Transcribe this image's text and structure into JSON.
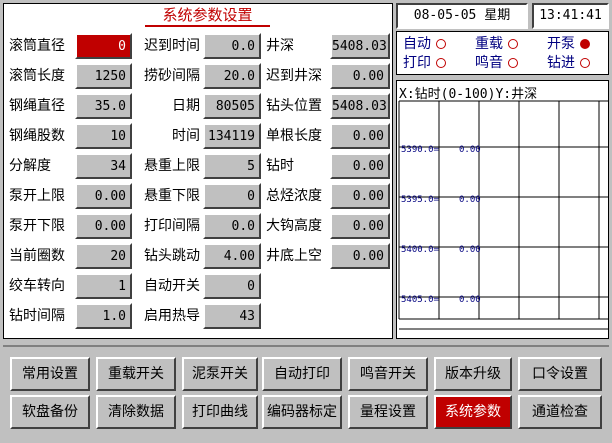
{
  "header": {
    "title": "系统参数设置",
    "date": "08-05-05",
    "weekday": "星期",
    "time": "13:41:41"
  },
  "params_col1": [
    {
      "label": "滚筒直径",
      "value": "0",
      "highlight": true
    },
    {
      "label": "滚筒长度",
      "value": "1250"
    },
    {
      "label": "钢绳直径",
      "value": "35.0"
    },
    {
      "label": "钢绳股数",
      "value": "10"
    },
    {
      "label": "分解度",
      "value": "34"
    },
    {
      "label": "泵开上限",
      "value": "0.00"
    },
    {
      "label": "泵开下限",
      "value": "0.00"
    },
    {
      "label": "当前圈数",
      "value": "20"
    },
    {
      "label": "绞车转向",
      "value": "1"
    },
    {
      "label": "钻时间隔",
      "value": "1.0"
    }
  ],
  "params_col2": [
    {
      "label": "迟到时间",
      "value": "0.0"
    },
    {
      "label": "捞砂间隔",
      "value": "20.0"
    },
    {
      "label": "日期",
      "value": "80505"
    },
    {
      "label": "时间",
      "value": "134119"
    },
    {
      "label": "悬重上限",
      "value": "5"
    },
    {
      "label": "悬重下限",
      "value": "0"
    },
    {
      "label": "打印间隔",
      "value": "0.0"
    },
    {
      "label": "钻头跳动",
      "value": "4.00"
    },
    {
      "label": "自动开关",
      "value": "0"
    },
    {
      "label": "启用热导",
      "value": "43"
    }
  ],
  "params_col3": [
    {
      "label": "井深",
      "value": "5408.03"
    },
    {
      "label": "迟到井深",
      "value": "0.00"
    },
    {
      "label": "钻头位置",
      "value": "5408.03"
    },
    {
      "label": "单根长度",
      "value": "0.00"
    },
    {
      "label": "钻时",
      "value": "0.00"
    },
    {
      "label": "总烃浓度",
      "value": "0.00"
    },
    {
      "label": "大钩高度",
      "value": "0.00"
    },
    {
      "label": "井底上空",
      "value": "0.00"
    }
  ],
  "indicators": [
    {
      "label": "自动",
      "on": false
    },
    {
      "label": "重载",
      "on": false
    },
    {
      "label": "开泵",
      "on": true
    },
    {
      "label": "打印",
      "on": false
    },
    {
      "label": "鸣音",
      "on": false
    },
    {
      "label": "钻进",
      "on": false
    }
  ],
  "trend": {
    "header": "X:钻时(0-100)Y:井深",
    "rows": [
      {
        "depth": "5390.0=",
        "value": "0.00"
      },
      {
        "depth": "5395.0=",
        "value": "0.00"
      },
      {
        "depth": "5400.0=",
        "value": "0.00"
      },
      {
        "depth": "5405.0=",
        "value": "0.00"
      }
    ]
  },
  "buttons_row1": [
    "常用设置",
    "重载开关",
    "泥泵开关",
    "自动打印",
    "鸣音开关",
    "版本升级",
    "口令设置"
  ],
  "buttons_row2": [
    "软盘备份",
    "清除数据",
    "打印曲线",
    "编码器标定",
    "量程设置",
    "系统参数",
    "通道检查"
  ],
  "active_button": "系统参数",
  "colors": {
    "accent": "#c00000",
    "panel": "#c0c0c0",
    "indicator_text": "#000080"
  }
}
